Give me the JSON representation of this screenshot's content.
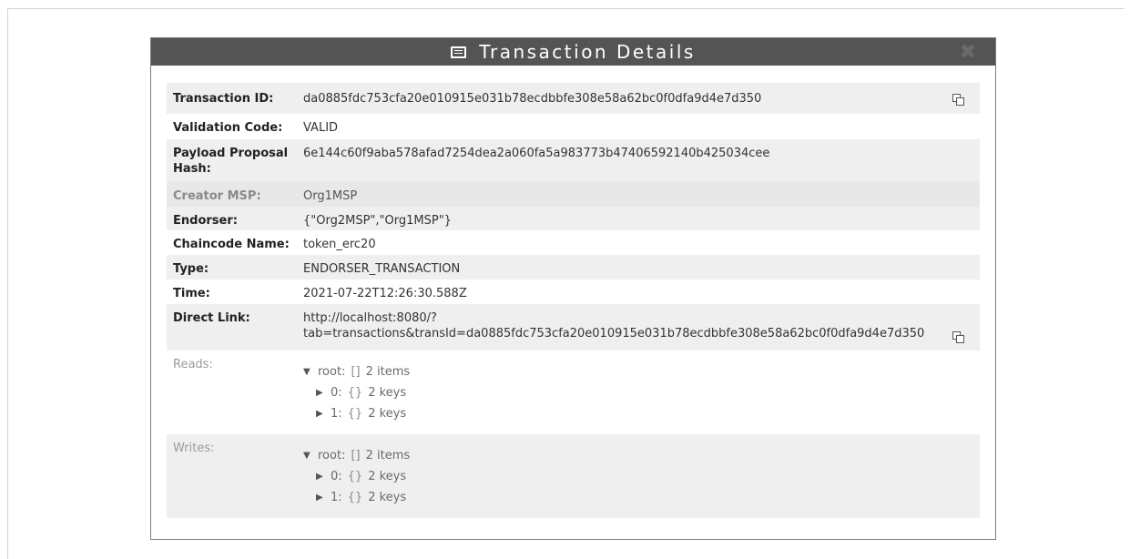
{
  "modal": {
    "title": "Transaction Details",
    "icon": "list-icon",
    "close_icon": "close-icon"
  },
  "rows": {
    "transaction_id": {
      "label": "Transaction ID:",
      "value": "da0885fdc753cfa20e010915e031b78ecdbbfe308e58a62bc0f0dfa9d4e7d350"
    },
    "validation_code": {
      "label": "Validation Code:",
      "value": "VALID"
    },
    "payload_label_line1": "Payload Proposal",
    "payload_label_line2": "Hash:",
    "payload_value": "6e144c60f9aba578afad7254dea2a060fa5a983773b47406592140b425034cee",
    "creator_msp": {
      "label": "Creator MSP:",
      "value": "Org1MSP"
    },
    "endorser": {
      "label": "Endorser:",
      "value": "{\"Org2MSP\",\"Org1MSP\"}"
    },
    "chaincode_name": {
      "label": "Chaincode Name:",
      "value": "token_erc20"
    },
    "type": {
      "label": "Type:",
      "value": "ENDORSER_TRANSACTION"
    },
    "time": {
      "label": "Time:",
      "value": "2021-07-22T12:26:30.588Z"
    },
    "direct_link": {
      "label": "Direct Link:",
      "value_line1": "http://localhost:8080/?",
      "value_line2": "tab=transactions&transId=da0885fdc753cfa20e010915e031b78ecdbbfe308e58a62bc0f0dfa9d4e7d350"
    },
    "reads": {
      "label": "Reads:",
      "root": {
        "key": "root:",
        "braces": "[]",
        "count": "2 items"
      },
      "children": [
        {
          "key": "0:",
          "braces": "{}",
          "count": "2 keys"
        },
        {
          "key": "1:",
          "braces": "{}",
          "count": "2 keys"
        }
      ]
    },
    "writes": {
      "label": "Writes:",
      "root": {
        "key": "root:",
        "braces": "[]",
        "count": "2 items"
      },
      "children": [
        {
          "key": "0:",
          "braces": "{}",
          "count": "2 keys"
        },
        {
          "key": "1:",
          "braces": "{}",
          "count": "2 keys"
        }
      ]
    }
  },
  "glyphs": {
    "expanded": "▼",
    "collapsed": "▶",
    "close": "✖"
  },
  "colors": {
    "header_bg": "#545454",
    "row_shade": "#efefef"
  }
}
